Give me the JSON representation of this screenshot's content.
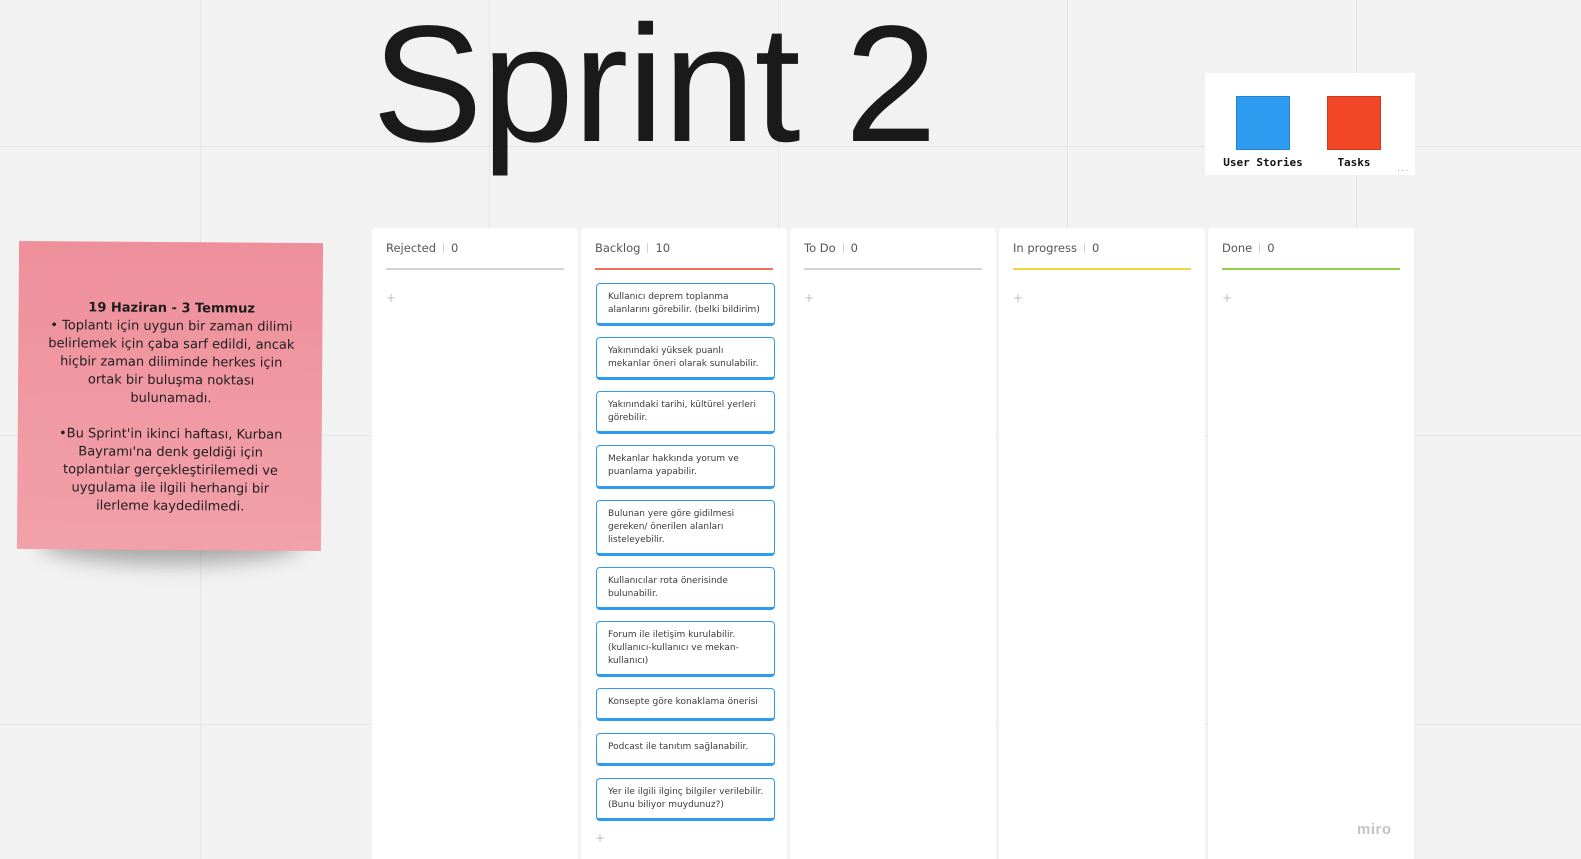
{
  "board": {
    "title": "Sprint 2",
    "watermark": "miro"
  },
  "legend": {
    "items": [
      {
        "label": "User Stories",
        "color": "#2d9bf0"
      },
      {
        "label": "Tasks",
        "color": "#f24726"
      }
    ],
    "more_glyph": "..."
  },
  "sticky_note": {
    "color": "#f09aa5",
    "heading": "19 Haziran - 3 Temmuz",
    "paragraph_1": "• Toplantı için uygun bir zaman dilimi belirlemek için çaba sarf edildi, ancak hiçbir zaman diliminde herkes için ortak bir buluşma noktası bulunamadı.",
    "paragraph_2": "•Bu Sprint'in ikinci haftası, Kurban Bayramı'na denk geldiği için toplantılar gerçekleştirilemedi ve uygulama ile ilgili herhangi bir ilerleme kaydedilmedi."
  },
  "kanban": {
    "add_glyph": "+",
    "columns": [
      {
        "name": "Rejected",
        "count": "0",
        "accent": "#d4d4d4"
      },
      {
        "name": "Backlog",
        "count": "10",
        "accent": "#f0715b"
      },
      {
        "name": "To Do",
        "count": "0",
        "accent": "#d4d4d4"
      },
      {
        "name": "In progress",
        "count": "0",
        "accent": "#f5d53d"
      },
      {
        "name": "Done",
        "count": "0",
        "accent": "#8fd14f"
      }
    ],
    "backlog_cards": [
      "Kullanıcı deprem toplanma alanlarını görebilir. (belki bildirim)",
      "Yakınındaki yüksek puanlı mekanlar öneri olarak sunulabilir.",
      "Yakınındaki tarihi, kültürel yerleri görebilir.",
      "Mekanlar hakkında yorum ve puanlama yapabilir.",
      "Bulunan yere göre gidilmesi gereken/ önerilen alanları listeleyebilir.",
      "Kullanıcılar rota önerisinde bulunabilir.",
      "Forum ile iletişim kurulabilir. (kullanıcı-kullanıcı ve mekan-kullanıcı)",
      "Konsepte göre konaklama önerisi",
      "Podcast ile tanıtım sağlanabilir.",
      "Yer ile ilgili ilginç bilgiler verilebilir. (Bunu biliyor muydunuz?)"
    ],
    "card_color": "#2d9bf0"
  }
}
